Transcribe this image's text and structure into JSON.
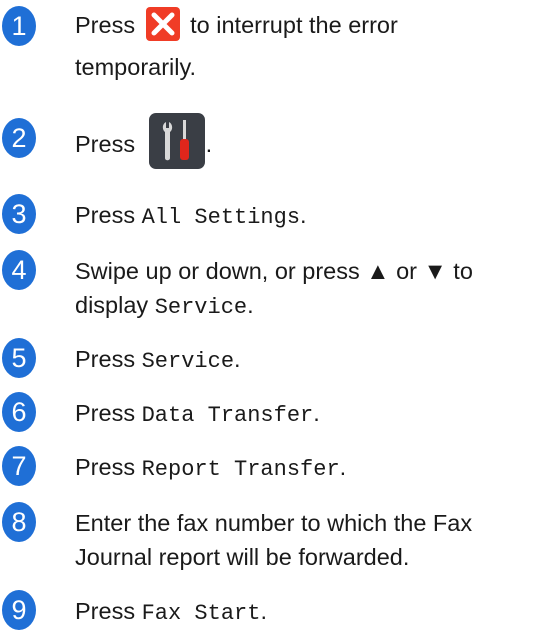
{
  "steps": [
    {
      "num": "1",
      "prefix": "Press",
      "suffix": "to interrupt the error",
      "line2": "temporarily.",
      "icon": "cancel-x-icon",
      "icon_color": "#f03c26"
    },
    {
      "num": "2",
      "prefix": "Press",
      "suffix": ".",
      "icon": "settings-tools-icon"
    },
    {
      "num": "3",
      "prefix": "Press",
      "code": "All Settings",
      "suffix": "."
    },
    {
      "num": "4",
      "line1": "Swipe up or down, or press ▲ or ▼ to",
      "line2_prefix": "display",
      "code": "Service",
      "suffix": "."
    },
    {
      "num": "5",
      "prefix": "Press",
      "code": "Service",
      "suffix": "."
    },
    {
      "num": "6",
      "prefix": "Press",
      "code": "Data Transfer",
      "suffix": "."
    },
    {
      "num": "7",
      "prefix": "Press",
      "code": "Report Transfer",
      "suffix": "."
    },
    {
      "num": "8",
      "line1": "Enter the fax number to which the Fax",
      "line2": "Journal report will be forwarded."
    },
    {
      "num": "9",
      "prefix": "Press",
      "code": "Fax Start",
      "suffix": "."
    }
  ],
  "colors": {
    "accent": "#1f6fd6",
    "error": "#f03c26"
  }
}
